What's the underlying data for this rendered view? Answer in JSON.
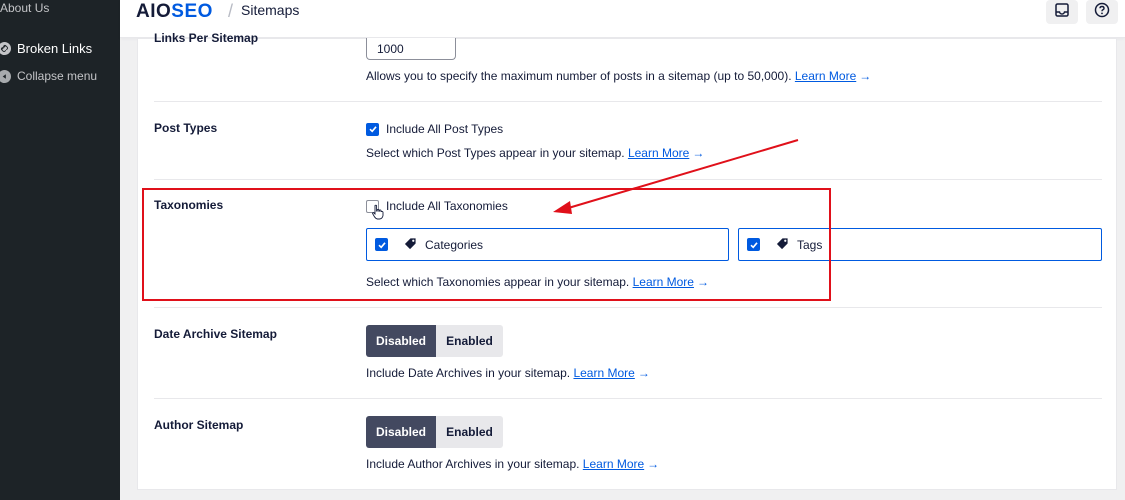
{
  "sidebar": {
    "about_us": "About Us",
    "broken_links": "Broken Links",
    "collapse_menu": "Collapse menu"
  },
  "header": {
    "logo_text_a": "AIO",
    "logo_text_b": "SEO",
    "separator": "/",
    "breadcrumb": "Sitemaps",
    "icons": [
      "inbox-icon",
      "help-icon"
    ]
  },
  "links_per_sitemap": {
    "label": "Links Per Sitemap",
    "value": "1000",
    "description": "Allows you to specify the maximum number of posts in a sitemap (up to 50,000).",
    "learn_more": "Learn More",
    "arrow": "→"
  },
  "post_types": {
    "label": "Post Types",
    "checkbox_label": "Include All Post Types",
    "checked": true,
    "description": "Select which Post Types appear in your sitemap.",
    "learn_more": "Learn More",
    "arrow": "→"
  },
  "taxonomies": {
    "label": "Taxonomies",
    "checkbox_label": "Include All Taxonomies",
    "checked": false,
    "items": [
      {
        "label": "Categories",
        "checked": true,
        "icon": "tag-icon"
      },
      {
        "label": "Tags",
        "checked": true,
        "icon": "tag-icon"
      }
    ],
    "description": "Select which Taxonomies appear in your sitemap.",
    "learn_more": "Learn More",
    "arrow": "→"
  },
  "date_archive": {
    "label": "Date Archive Sitemap",
    "disabled": "Disabled",
    "enabled": "Enabled",
    "selected": "Disabled",
    "description": "Include Date Archives in your sitemap.",
    "learn_more": "Learn More",
    "arrow": "→"
  },
  "author_sitemap": {
    "label": "Author Sitemap",
    "disabled": "Disabled",
    "enabled": "Enabled",
    "selected": "Disabled",
    "description": "Include Author Archives in your sitemap.",
    "learn_more": "Learn More",
    "arrow": "→"
  },
  "colors": {
    "accent": "#005ae0",
    "annotation": "#e0101a",
    "toggle_active": "#434960"
  }
}
